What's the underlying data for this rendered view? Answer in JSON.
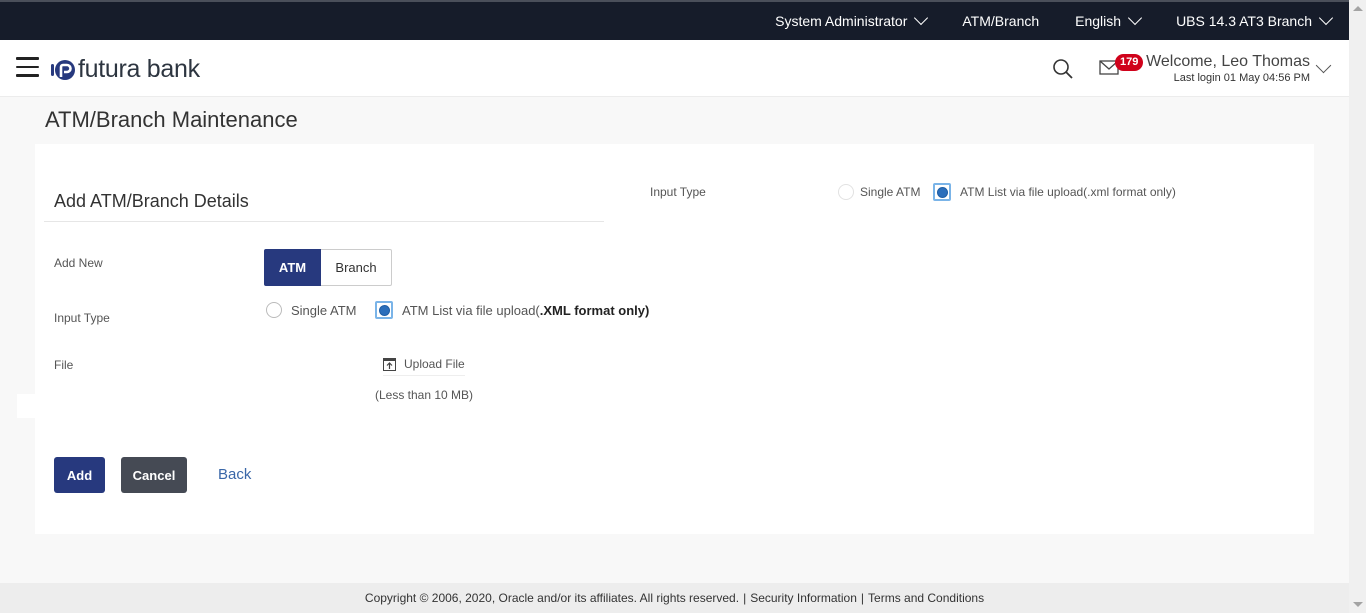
{
  "topbar": {
    "role": "System Administrator",
    "module": "ATM/Branch",
    "language": "English",
    "entity": "UBS 14.3 AT3 Branch"
  },
  "header": {
    "brand": "futura bank",
    "notification_count": "179",
    "welcome": "Welcome, Leo Thomas",
    "last_login": "Last login 01 May 04:56 PM",
    "icons": {
      "menu": "hamburger-icon",
      "search": "search-icon",
      "mail": "mail-icon",
      "user_menu": "chevron-down-icon"
    }
  },
  "page": {
    "title": "ATM/Branch Maintenance"
  },
  "form": {
    "section_title": "Add ATM/Branch Details",
    "right_panel": {
      "label": "Input Type",
      "options": [
        "Single ATM",
        "ATM List via file upload(.xml format only)"
      ],
      "selected": 1
    },
    "add_new": {
      "label": "Add New",
      "options": [
        "ATM",
        "Branch"
      ],
      "selected": "ATM"
    },
    "input_type": {
      "label": "Input Type",
      "option_single": "Single ATM",
      "option_file_prefix": "ATM List via file upload(",
      "option_file_bold": ".XML format only)",
      "selected": "file"
    },
    "file": {
      "label": "File",
      "upload_label": "Upload File",
      "size_note": "(Less than 10 MB)"
    },
    "actions": {
      "add": "Add",
      "cancel": "Cancel",
      "back": "Back"
    }
  },
  "footer": {
    "copyright": "Copyright © 2006, 2020, Oracle and/or its affiliates. All rights reserved.",
    "separator": "|",
    "security": "Security Information",
    "terms": "Terms and Conditions"
  },
  "colors": {
    "topbar_bg": "#161c2a",
    "primary": "#27397e",
    "secondary": "#454a54",
    "link": "#3a67a8",
    "badge": "#d0021b"
  }
}
